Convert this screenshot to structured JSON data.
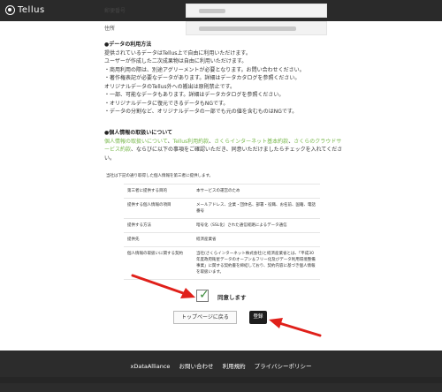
{
  "header": {
    "logo_text": "Tellus"
  },
  "form": {
    "postal_label": "郵便番号",
    "address_label": "住所"
  },
  "data_usage": {
    "title": "●データの利用方法",
    "lines": [
      "提供されているデータはTellus上で自由に利用いただけます。",
      "ユーザーが作成した二次成果物は自由に利用いただけます。",
      "・商用利用の際は、別途アグリーメントが必要となります。お問い合わせください。",
      "・著作権表記が必要なデータがあります。詳細はデータカタログを参照ください。",
      "オリジナルデータのTellus外への搬出は原則禁止です。",
      "・一部、可能なデータもあります。詳細はデータカタログを参照ください。",
      "・オリジナルデータに復元できるデータもNGです。",
      "・データの分割など、オリジナルデータの一部でも元の値を含むものはNGです。"
    ]
  },
  "privacy": {
    "title": "●個人情報の取扱いについて",
    "link1": "個人情報の取扱いについて",
    "sep1": "、",
    "link2": "Tellus利用約款",
    "sep2": "、",
    "link3": "さくらインターネット基本約款",
    "sep3": "、",
    "link4": "さくらのクラウドサービス約款",
    "tail": "、ならびに以下の事項をご確認いただき、同意いただけましたらチェックを入れてください。"
  },
  "third_party_note": "当社は下記の通り取得した個人情報を第三者に提供します。",
  "info_table": [
    {
      "label": "第三者に提供する目的",
      "value": "本サービスの運営のため"
    },
    {
      "label": "提供する個人情報の項目",
      "value": "メールアドレス、企業・団体名、部署・役職、お名前、国籍、電話番号"
    },
    {
      "label": "提供する方法",
      "value": "暗号化（SSL化）された通信経路によるデータ通信"
    },
    {
      "label": "提供先",
      "value": "経済産業省"
    },
    {
      "label": "個人情報の取扱いに関する契約",
      "value": "当社(さくらインターネット株式会社)と経済産業省とは、「平成30年度政府衛星データのオープン＆フリー化及びデータ利用環境整備事業」に関する契約書を締結しており、契約内容に基づき個人情報を取扱います。"
    }
  ],
  "agree": {
    "label": "同意します",
    "checked": true
  },
  "buttons": {
    "top_page": "トップページに戻る",
    "register": "登録"
  },
  "footer": {
    "items": [
      "xDataAlliance",
      "お問い合わせ",
      "利用規約",
      "プライバシーポリシー"
    ]
  },
  "colors": {
    "topbar": "#2a2a2a",
    "link_green": "#79b84d",
    "arrow_red": "#e0201a",
    "footer": "#2c2c2c"
  },
  "icons": {
    "checkbox": "check-icon",
    "annotation": "red-arrow"
  }
}
